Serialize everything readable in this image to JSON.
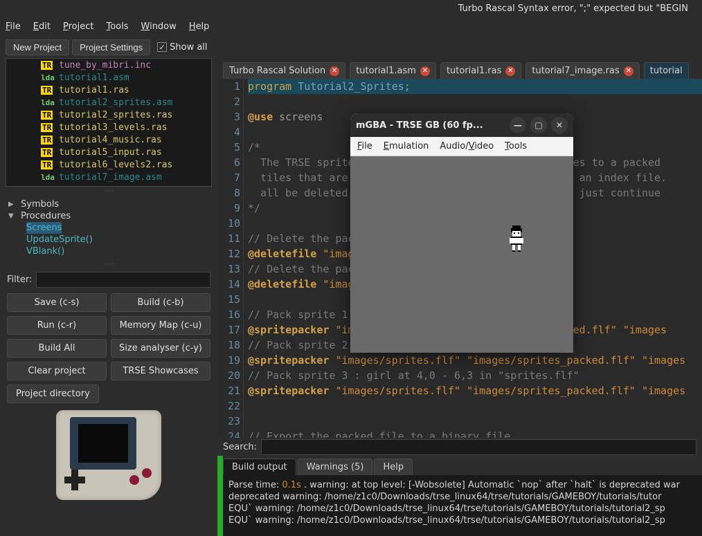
{
  "titlebar": "Turbo Rascal Syntax error, \";\" expected but \"BEGIN",
  "menubar": [
    "File",
    "Edit",
    "Project",
    "Tools",
    "Window",
    "Help"
  ],
  "toolbar": {
    "new_project": "New Project",
    "project_settings": "Project Settings",
    "show_all": "Show all",
    "show_all_checked": true
  },
  "file_tree": [
    {
      "badge": "TR",
      "name": "tune_by_mibri.inc",
      "cls": "fn-purple"
    },
    {
      "badge": "lda",
      "name": "tutorial1.asm",
      "cls": "fn-teal"
    },
    {
      "badge": "TR",
      "name": "tutorial1.ras",
      "cls": "fn-yellow"
    },
    {
      "badge": "lda",
      "name": "tutorial2_sprites.asm",
      "cls": "fn-teal"
    },
    {
      "badge": "TR",
      "name": "tutorial2_sprites.ras",
      "cls": "fn-yellow"
    },
    {
      "badge": "TR",
      "name": "tutorial3_levels.ras",
      "cls": "fn-yellow"
    },
    {
      "badge": "TR",
      "name": "tutorial4_music.ras",
      "cls": "fn-yellow"
    },
    {
      "badge": "TR",
      "name": "tutorial5_input.ras",
      "cls": "fn-yellow"
    },
    {
      "badge": "TR",
      "name": "tutorial6_levels2.ras",
      "cls": "fn-yellow"
    },
    {
      "badge": "lda",
      "name": "tutorial7_image.asm",
      "cls": "fn-teal"
    }
  ],
  "symbols": {
    "symbols_label": "Symbols",
    "procedures_label": "Procedures",
    "procedures": [
      "Screens",
      "UpdateSprite()",
      "VBlank()"
    ]
  },
  "filter_label": "Filter:",
  "filter_value": "",
  "buttons": {
    "save": "Save (c-s)",
    "build": "Build (c-b)",
    "run": "Run (c-r)",
    "memmap": "Memory Map (c-u)",
    "buildall": "Build All",
    "sizean": "Size analyser (c-y)",
    "clear": "Clear project",
    "showcases": "TRSE Showcases",
    "projdir": "Project directory"
  },
  "tabs": [
    {
      "label": "Turbo Rascal Solution",
      "close": true,
      "active": false
    },
    {
      "label": "tutorial1.asm",
      "close": true,
      "active": false
    },
    {
      "label": "tutorial1.ras",
      "close": true,
      "active": false
    },
    {
      "label": "tutorial7_image.ras",
      "close": true,
      "active": false
    },
    {
      "label": "tutorial",
      "close": false,
      "active": true
    }
  ],
  "code": {
    "start_line": 1,
    "lines": [
      {
        "raw": "program Tutorial2_Sprites;",
        "tokens": [
          [
            "kw",
            "program"
          ],
          [
            "plain",
            " "
          ],
          [
            "id",
            "Tutorial2_Sprites"
          ],
          [
            "plain",
            ";"
          ]
        ],
        "hl": true
      },
      {
        "raw": ""
      },
      {
        "raw": "@use screens",
        "tokens": [
          [
            "kw-at",
            "@use"
          ],
          [
            "plain",
            " screens"
          ]
        ]
      },
      {
        "raw": ""
      },
      {
        "raw": "/*",
        "tokens": [
          [
            "comment",
            "/*"
          ]
        ]
      },
      {
        "raw": "  The TRSE sprite                             f files to a packed ",
        "tokens": [
          [
            "comment",
            "  The TRSE sprite                              f files to a packed "
          ]
        ]
      },
      {
        "raw": "  tiles that are e                             ed to an index file.",
        "tokens": [
          [
            "comment",
            "  tiles that are e                             ed to an index file."
          ]
        ]
      },
      {
        "raw": "  all be deleted &                             ey'll just continue ",
        "tokens": [
          [
            "comment",
            "  all be deleted &                             ey'll just continue "
          ]
        ]
      },
      {
        "raw": "*/",
        "tokens": [
          [
            "comment",
            "*/"
          ]
        ]
      },
      {
        "raw": ""
      },
      {
        "raw": "// Delete the pac",
        "tokens": [
          [
            "comment",
            "// Delete the pac"
          ]
        ]
      },
      {
        "raw": "@deletefile \"imag",
        "tokens": [
          [
            "kw-at",
            "@deletefile"
          ],
          [
            "plain",
            " "
          ],
          [
            "str",
            "\"imag"
          ]
        ]
      },
      {
        "raw": "// Delete the pac",
        "tokens": [
          [
            "comment",
            "// Delete the pac"
          ]
        ]
      },
      {
        "raw": "@deletefile \"imag",
        "tokens": [
          [
            "kw-at",
            "@deletefile"
          ],
          [
            "plain",
            " "
          ],
          [
            "str",
            "\"imag"
          ]
        ]
      },
      {
        "raw": ""
      },
      {
        "raw": "// Pack sprite 1                               lf\"",
        "tokens": [
          [
            "comment",
            "// Pack sprite 1                               lf\""
          ]
        ]
      },
      {
        "raw": "@spritepacker \"im                              _packed.flf\" \"images",
        "tokens": [
          [
            "kw-at",
            "@spritepacker"
          ],
          [
            "plain",
            " "
          ],
          [
            "str",
            "\"im                              _packed.flf\""
          ],
          [
            "plain",
            " "
          ],
          [
            "str",
            "\"images"
          ]
        ]
      },
      {
        "raw": "// Pack sprite 2                               lf\"",
        "tokens": [
          [
            "comment",
            "// Pack sprite 2                               lf\""
          ]
        ]
      },
      {
        "raw": "@spritepacker \"images/sprites.flf\" \"images/sprites_packed.flf\" \"images",
        "tokens": [
          [
            "kw-at",
            "@spritepacker"
          ],
          [
            "plain",
            " "
          ],
          [
            "str",
            "\"images/sprites.flf\""
          ],
          [
            "plain",
            " "
          ],
          [
            "str",
            "\"images/sprites_packed.flf\""
          ],
          [
            "plain",
            " "
          ],
          [
            "str",
            "\"images"
          ]
        ]
      },
      {
        "raw": "// Pack sprite 3 : girl at 4,0 - 6,3 in \"sprites.flf\"",
        "tokens": [
          [
            "comment",
            "// Pack sprite 3 : girl at 4,0 - 6,3 in \"sprites.flf\""
          ]
        ]
      },
      {
        "raw": "@spritepacker \"images/sprites.flf\" \"images/sprites_packed.flf\" \"images",
        "tokens": [
          [
            "kw-at",
            "@spritepacker"
          ],
          [
            "plain",
            " "
          ],
          [
            "str",
            "\"images/sprites.flf\""
          ],
          [
            "plain",
            " "
          ],
          [
            "str",
            "\"images/sprites_packed.flf\""
          ],
          [
            "plain",
            " "
          ],
          [
            "str",
            "\"images"
          ]
        ]
      },
      {
        "raw": ""
      },
      {
        "raw": ""
      },
      {
        "raw": "// Export the packed file to a binary file",
        "tokens": [
          [
            "comment",
            "// Export the packed file to a binary file"
          ]
        ]
      }
    ]
  },
  "search_label": "Search:",
  "search_value": "",
  "output": {
    "tabs": [
      "Build output",
      "Warnings (5)",
      "Help"
    ],
    "active_tab": 0,
    "lines": [
      "Parse time: <orange>0.1s</orange> . warning: at top level: [-Wobsolete] Automatic `nop` after `halt` is deprecated war",
      "deprecated warning: /home/z1c0/Downloads/trse_linux64/trse/tutorials/GAMEBOY/tutorials/tutor",
      "EQU` warning: /home/z1c0/Downloads/trse_linux64/trse/tutorials/GAMEBOY/tutorials/tutorial2_sp",
      "EQU` warning: /home/z1c0/Downloads/trse_linux64/trse/tutorials/GAMEBOY/tutorials/tutorial2_sp"
    ]
  },
  "mgba": {
    "title": "mGBA - TRSE GB (60 fp...",
    "menu": [
      "File",
      "Emulation",
      "Audio/Video",
      "Tools"
    ]
  }
}
